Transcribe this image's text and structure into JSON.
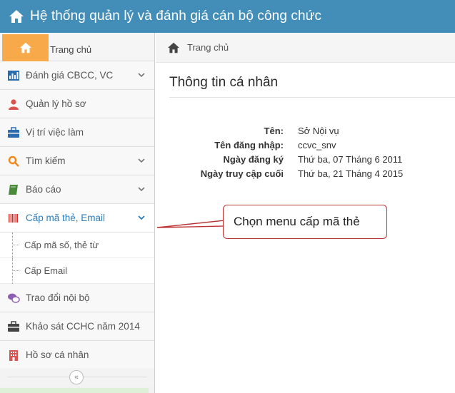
{
  "header": {
    "title": "Hệ thống quản lý và đánh giá cán bộ công chức"
  },
  "sidebar": {
    "home_label": "Trang chủ",
    "items": [
      {
        "label": "Đánh giá CBCC, VC",
        "icon": "bar-chart-icon",
        "has_chevron": true
      },
      {
        "label": "Quản lý hồ sơ",
        "icon": "user-icon",
        "has_chevron": false
      },
      {
        "label": "Vị trí việc làm",
        "icon": "briefcase-icon",
        "has_chevron": false
      },
      {
        "label": "Tìm kiếm",
        "icon": "search-icon",
        "has_chevron": true
      },
      {
        "label": "Báo cáo",
        "icon": "book-icon",
        "has_chevron": true
      },
      {
        "label": "Cấp mã thẻ, Email",
        "icon": "barcode-icon",
        "has_chevron": true,
        "active": true
      },
      {
        "label": "Trao đổi nội bộ",
        "icon": "chat-icon",
        "has_chevron": false
      },
      {
        "label": "Khảo sát CCHC năm 2014",
        "icon": "briefcase-icon",
        "has_chevron": false
      },
      {
        "label": "Hồ sơ cá nhân",
        "icon": "building-icon",
        "has_chevron": false
      }
    ],
    "subitems": [
      {
        "label": "Cấp mã số, thẻ từ"
      },
      {
        "label": "Cấp Email"
      }
    ],
    "collapse_symbol": "«"
  },
  "breadcrumb": {
    "label": "Trang chủ"
  },
  "main": {
    "title": "Thông tin cá nhân",
    "info": [
      {
        "label": "Tên:",
        "value": "Sở Nội vụ"
      },
      {
        "label": "Tên đăng nhập:",
        "value": "ccvc_snv"
      },
      {
        "label": "Ngày đăng ký",
        "value": "Thứ ba, 07 Tháng 6 2011"
      },
      {
        "label": "Ngày truy cập cuối",
        "value": "Thứ ba, 21 Tháng 4 2015"
      }
    ]
  },
  "callout": {
    "text": "Chọn menu cấp mã thẻ"
  },
  "colors": {
    "topbar": "#438eb9",
    "home_tile": "#f8a94a",
    "active_text": "#2b7dbc",
    "callout_border": "#b33333"
  }
}
